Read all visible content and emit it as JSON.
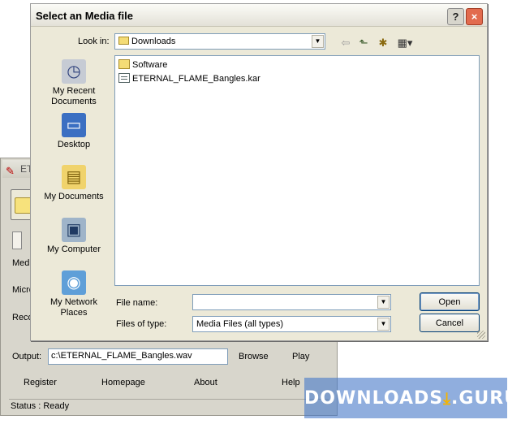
{
  "app": {
    "title": "ET",
    "side_labels": [
      "Medi",
      "Micro",
      "Reco"
    ],
    "output_label": "Output:",
    "output_value": "c:\\ETERNAL_FLAME_Bangles.wav",
    "browse_label": "Browse",
    "play_label": "Play",
    "register_label": "Register",
    "homepage_label": "Homepage",
    "about_label": "About",
    "help_label": "Help",
    "status_text": "Status : Ready"
  },
  "dialog": {
    "title": "Select an Media file",
    "help_btn": "?",
    "close_btn": "×",
    "look_in_label": "Look in:",
    "look_in_value": "Downloads",
    "places": [
      {
        "label": "My Recent\nDocuments",
        "icon": "recent-documents-icon"
      },
      {
        "label": "Desktop",
        "icon": "desktop-icon"
      },
      {
        "label": "My Documents",
        "icon": "my-documents-icon"
      },
      {
        "label": "My Computer",
        "icon": "my-computer-icon"
      },
      {
        "label": "My Network\nPlaces",
        "icon": "network-places-icon"
      }
    ],
    "files": [
      {
        "name": "Software",
        "type": "folder"
      },
      {
        "name": "ETERNAL_FLAME_Bangles.kar",
        "type": "file"
      }
    ],
    "file_name_label": "File name:",
    "file_name_value": "",
    "files_of_type_label": "Files of type:",
    "files_of_type_value": "Media Files (all types)",
    "open_label": "Open",
    "cancel_label": "Cancel"
  },
  "watermark": {
    "text_left": "DOWNLOADS",
    "text_right": ".GURU"
  }
}
